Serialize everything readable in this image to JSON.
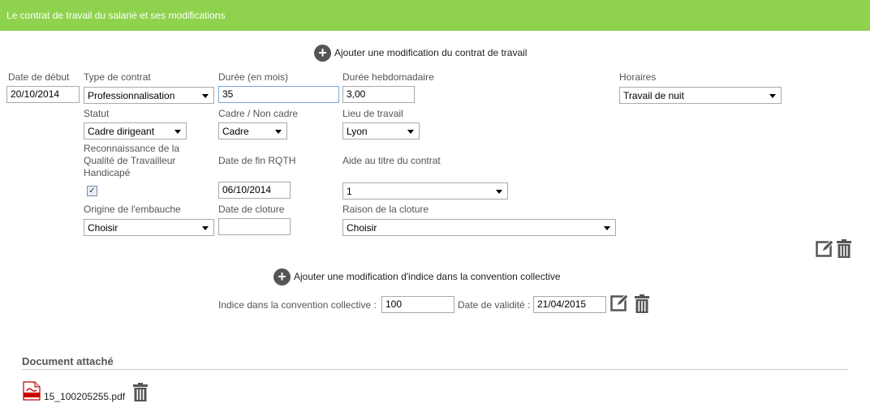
{
  "header": {
    "title": "Le contrat de travail du salarié et ses modifications"
  },
  "actions": {
    "add_contract_modification": "Ajouter une modification du contrat de travail",
    "add_index_modification": "Ajouter une modification d'indice dans la convention collective"
  },
  "form": {
    "date_debut": {
      "label": "Date de début",
      "value": "20/10/2014"
    },
    "type_contrat": {
      "label": "Type de contrat",
      "value": "Professionnalisation"
    },
    "duree": {
      "label": "Durée (en mois)",
      "value": "35"
    },
    "duree_hebdo": {
      "label": "Durée hebdomadaire",
      "value": "3,00"
    },
    "horaires": {
      "label": "Horaires",
      "value": "Travail de nuit"
    },
    "statut": {
      "label": "Statut",
      "value": "Cadre dirigeant"
    },
    "cadre": {
      "label": "Cadre / Non cadre",
      "value": "Cadre"
    },
    "lieu": {
      "label": "Lieu de travail",
      "value": "Lyon"
    },
    "rqth": {
      "label": "Reconnaissance de la Qualité de Travailleur Handicapé",
      "checked": true
    },
    "date_fin_rqth": {
      "label": "Date de fin RQTH",
      "value": "06/10/2014"
    },
    "aide": {
      "label": "Aide au titre du contrat",
      "value": "1"
    },
    "origine": {
      "label": "Origine de l'embauche",
      "value": "Choisir"
    },
    "date_cloture": {
      "label": "Date de cloture",
      "value": ""
    },
    "raison_cloture": {
      "label": "Raison de la cloture",
      "value": "Choisir"
    }
  },
  "indice": {
    "label": "Indice dans la convention collective :",
    "value": "100",
    "date_label": "Date de validité :",
    "date_value": "21/04/2015"
  },
  "documents": {
    "title": "Document attaché",
    "files": [
      {
        "name": "15_100205255.pdf"
      }
    ]
  },
  "colors": {
    "header_bg": "#8fd24e",
    "icon": "#555555"
  }
}
